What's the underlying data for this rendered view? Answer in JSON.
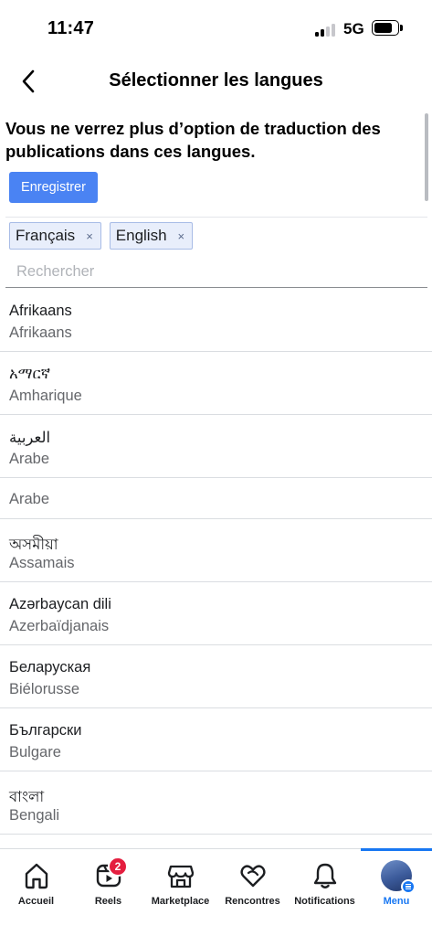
{
  "status_bar": {
    "time": "11:47",
    "network": "5G",
    "battery_level": 0.8
  },
  "header": {
    "title": "Sélectionner les langues",
    "back_icon": "chevron-left-icon"
  },
  "notice": "Vous ne verrez plus d’option de traduction des publications dans ces langues.",
  "save_label": "Enregistrer",
  "selected_languages": [
    {
      "label": "Français",
      "remove": "×"
    },
    {
      "label": "English",
      "remove": "×"
    }
  ],
  "search": {
    "placeholder": "Rechercher",
    "value": ""
  },
  "languages": [
    {
      "native": "Afrikaans",
      "name": "Afrikaans"
    },
    {
      "native": "አማርኛ",
      "name": "Amharique"
    },
    {
      "native": "العربية",
      "name": "Arabe"
    },
    {
      "native": "",
      "name": "Arabe"
    },
    {
      "native": "অসমীয়া",
      "name": "Assamais"
    },
    {
      "native": "Azərbaycan dili",
      "name": "Azerbaïdjanais"
    },
    {
      "native": "Беларуская",
      "name": "Biélorusse"
    },
    {
      "native": "Български",
      "name": "Bulgare"
    },
    {
      "native": "বাংলা",
      "name": "Bengali"
    }
  ],
  "tabbar": {
    "tabs": [
      {
        "label": "Accueil",
        "icon": "home-icon"
      },
      {
        "label": "Reels",
        "icon": "reels-icon",
        "badge": "2"
      },
      {
        "label": "Marketplace",
        "icon": "marketplace-icon"
      },
      {
        "label": "Rencontres",
        "icon": "dating-heart-icon"
      },
      {
        "label": "Notifications",
        "icon": "bell-icon"
      },
      {
        "label": "Menu",
        "icon": "profile-avatar",
        "active": true
      }
    ]
  },
  "colors": {
    "accent": "#1877f2",
    "save_button": "#4a83f3",
    "badge": "#e41e3f",
    "chip_background": "#e8eefb",
    "chip_border": "#a8bce6"
  }
}
